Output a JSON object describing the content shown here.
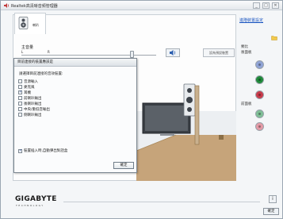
{
  "window": {
    "title": "Realtek高清晰音频管理器",
    "minimize": "_",
    "maximize": "□",
    "close": "✕"
  },
  "tab": {
    "label": "喇叭"
  },
  "volume": {
    "label": "主音量",
    "left": "L",
    "right": "R",
    "level": 0.82,
    "set_default_label": "設為預設裝置"
  },
  "right_panel": {
    "advanced_link": "進階裝置設定",
    "back_label": "後面板",
    "front_label": "前面板",
    "jack_colors_back": [
      "#8fa3d6",
      "#1f8a3a",
      "#c83a4a"
    ],
    "jack_colors_front": [
      "#7fbf96",
      "#e49aa6"
    ]
  },
  "dialog": {
    "title": "目前連接的裝置應該是",
    "prompt": "請選擇目前連接的音效裝置:",
    "items": [
      "音源輸入",
      "麥克風",
      "耳機",
      "前喇叭輸出",
      "後喇叭輸出",
      "中央/重低音輸出",
      "側喇叭輸出"
    ],
    "checked": [
      false,
      false,
      true,
      false,
      false,
      false,
      false
    ],
    "auto_popup_label": "裝置插入時,自動彈出對話盒",
    "auto_popup_checked": true,
    "ok_label": "確定"
  },
  "footer": {
    "logo": "GIGABYTE",
    "logo_sub": "TECHNOLOGY",
    "info": "i",
    "ok_label": "確定"
  },
  "colors": {
    "accent": "#1a55c0",
    "floor": "#c6a47a"
  }
}
